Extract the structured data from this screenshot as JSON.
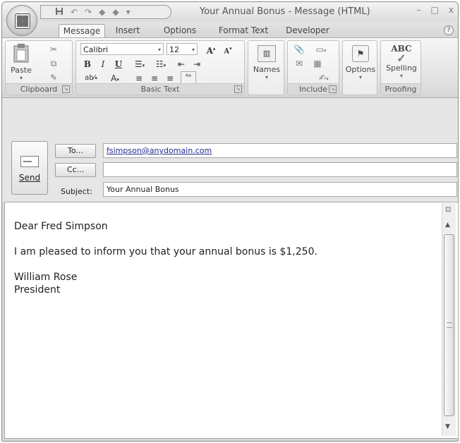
{
  "window": {
    "title": "Your Annual Bonus - Message (HTML)",
    "minimize": "–",
    "maximize": "□",
    "close": "x"
  },
  "qat_icons": [
    "save-icon",
    "undo-icon",
    "redo-icon",
    "previous-icon",
    "next-icon",
    "customize-icon"
  ],
  "tabs": [
    {
      "label": "Message",
      "active": true
    },
    {
      "label": "Insert"
    },
    {
      "label": "Options"
    },
    {
      "label": "Format Text"
    },
    {
      "label": "Developer"
    }
  ],
  "ribbon": {
    "clipboard": {
      "paste": "Paste",
      "label": "Clipboard"
    },
    "basic_text": {
      "font_name": "Calibri",
      "font_size": "12",
      "bold": "B",
      "italic": "I",
      "underline": "U",
      "grow": "A",
      "shrink": "A",
      "font_color": "A",
      "label": "Basic Text"
    },
    "names": {
      "label": "Names"
    },
    "include": {
      "label": "Include"
    },
    "options": {
      "label": "Options"
    },
    "proofing": {
      "icon_text": "ABC",
      "spelling": "Spelling",
      "label": "Proofing"
    }
  },
  "header": {
    "send": "Send",
    "to_button": "To...",
    "cc_button": "Cc...",
    "subject_label": "Subject:",
    "to_value": "fsimpson@anydomain.com",
    "cc_value": "",
    "subject_value": "Your Annual Bonus"
  },
  "body": {
    "greeting": "Dear Fred Simpson",
    "line1": "I am pleased to inform you that your annual bonus is $1,250.",
    "signature_name": "William Rose",
    "signature_title": "President"
  }
}
